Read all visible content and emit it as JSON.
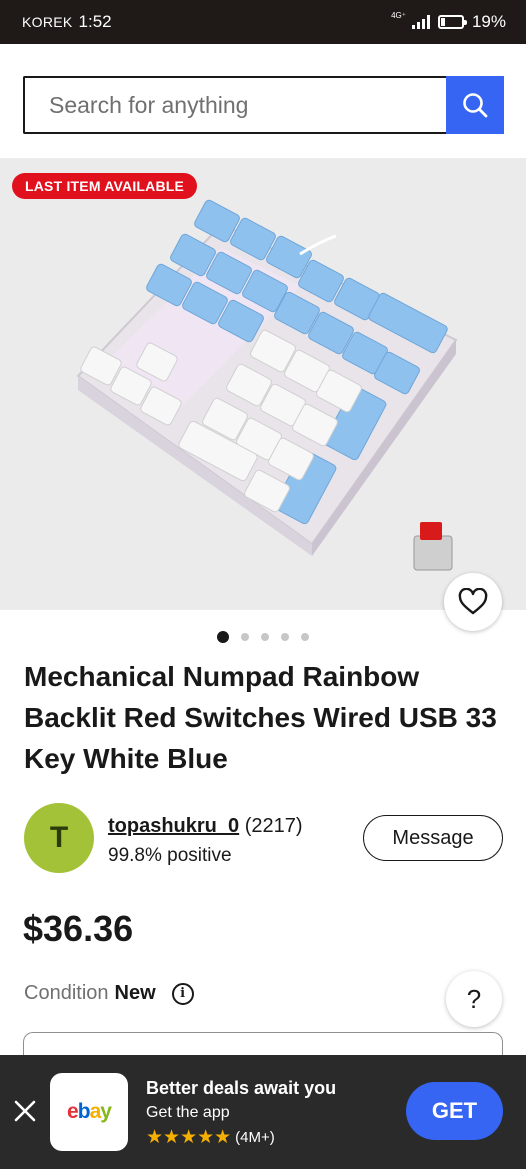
{
  "status_bar": {
    "carrier": "KOREK",
    "time": "1:52",
    "network": "4G⁺",
    "battery": "19%",
    "battery_level": 0.19
  },
  "search": {
    "placeholder": "Search for anything",
    "icon": "search-icon"
  },
  "gallery": {
    "badge": "LAST ITEM AVAILABLE",
    "image_count": 5,
    "active_index": 0,
    "favorite_icon": "heart-icon"
  },
  "listing": {
    "title": "Mechanical Numpad Rainbow Backlit Red Switches Wired USB 33 Key White Blue",
    "price": "$36.36",
    "condition_label": "Condition",
    "condition_value": "New"
  },
  "seller": {
    "initial": "T",
    "username": "topashukru_0",
    "feedback_count": "(2217)",
    "positive": "99.8% positive",
    "message_label": "Message"
  },
  "help_label": "?",
  "app_banner": {
    "headline": "Better deals await you",
    "subtext": "Get the app",
    "stars": "★★★★★",
    "rating_count": "(4M+)",
    "cta": "GET",
    "logo": {
      "e": "e",
      "b": "b",
      "a": "a",
      "y": "y"
    }
  },
  "colors": {
    "accent": "#3665f3",
    "badge_red": "#e0101c",
    "avatar_green": "#a3c237",
    "banner_bg": "#2a2a2a"
  }
}
